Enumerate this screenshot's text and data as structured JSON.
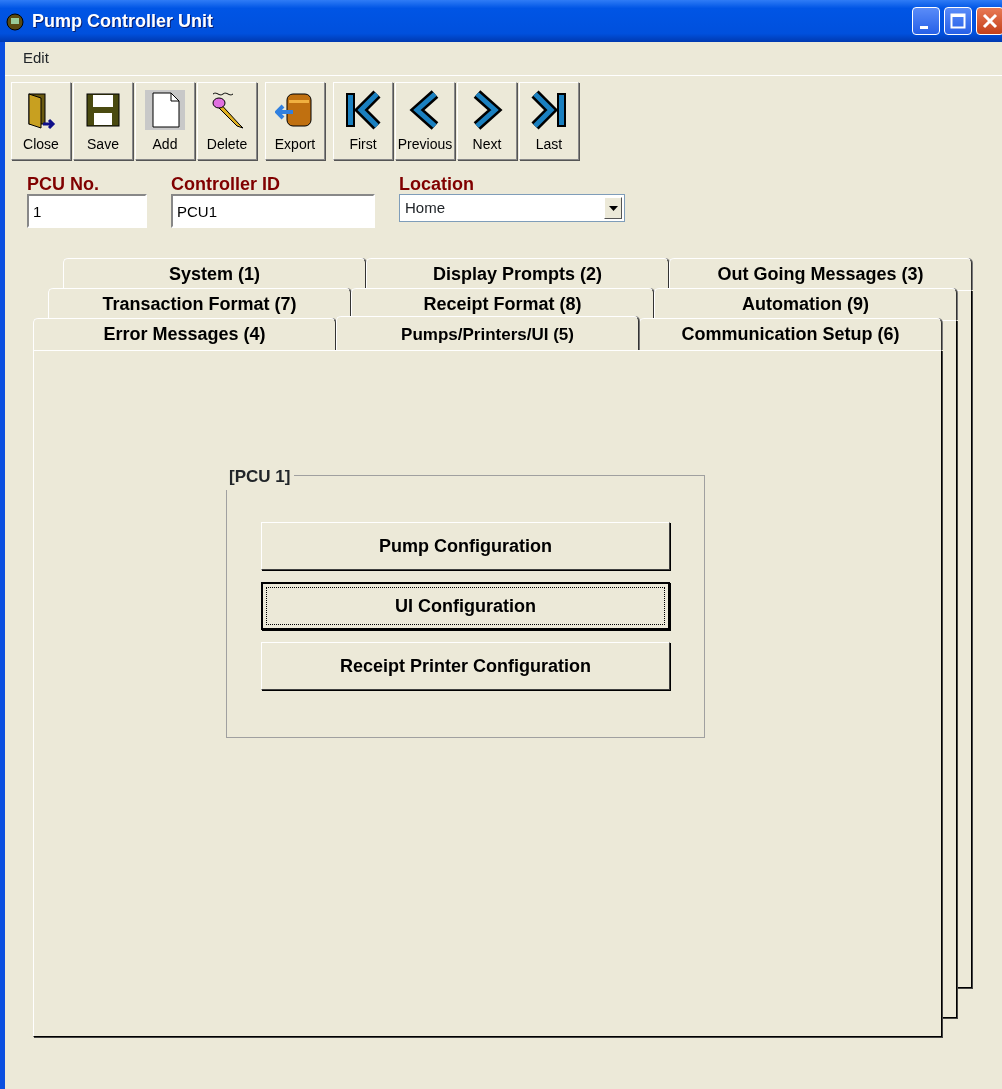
{
  "window": {
    "title": "Pump Controller Unit"
  },
  "menu": [
    "Edit"
  ],
  "toolbar": [
    [
      {
        "label": "Close",
        "kind": "door"
      },
      {
        "label": "Save",
        "kind": "disk"
      },
      {
        "label": "Add",
        "kind": "page"
      },
      {
        "label": "Delete",
        "kind": "eraser"
      }
    ],
    [
      {
        "label": "Export",
        "kind": "barrel"
      }
    ],
    [
      {
        "label": "First",
        "kind": "first"
      },
      {
        "label": "Previous",
        "kind": "prev"
      },
      {
        "label": "Next",
        "kind": "next"
      },
      {
        "label": "Last",
        "kind": "last"
      }
    ]
  ],
  "fields": [
    {
      "label": "PCU No.",
      "value": "1",
      "kind": "text"
    },
    {
      "label": "Controller ID",
      "value": "PCU1",
      "kind": "text"
    },
    {
      "label": "Location",
      "value": "Home",
      "kind": "dropdown"
    }
  ],
  "tab_rows": [
    [
      {
        "label": "System (1)",
        "selected": false
      },
      {
        "label": "Display Prompts (2)",
        "selected": false
      },
      {
        "label": "Out Going Messages (3)",
        "selected": false
      }
    ],
    [
      {
        "label": "Transaction Format (7)",
        "selected": false
      },
      {
        "label": "Receipt Format (8)",
        "selected": false
      },
      {
        "label": "Automation (9)",
        "selected": false
      }
    ],
    [
      {
        "label": "Error Messages (4)",
        "selected": false
      },
      {
        "label": "Pumps/Printers/UI (5)",
        "selected": true
      },
      {
        "label": "Communication Setup (6)",
        "selected": false
      }
    ]
  ],
  "group": {
    "title": "[PCU 1]",
    "buttons": [
      {
        "label": "Pump Configuration",
        "focused": false
      },
      {
        "label": "UI Configuration",
        "focused": true
      },
      {
        "label": "Receipt Printer Configuration",
        "focused": false
      }
    ]
  }
}
